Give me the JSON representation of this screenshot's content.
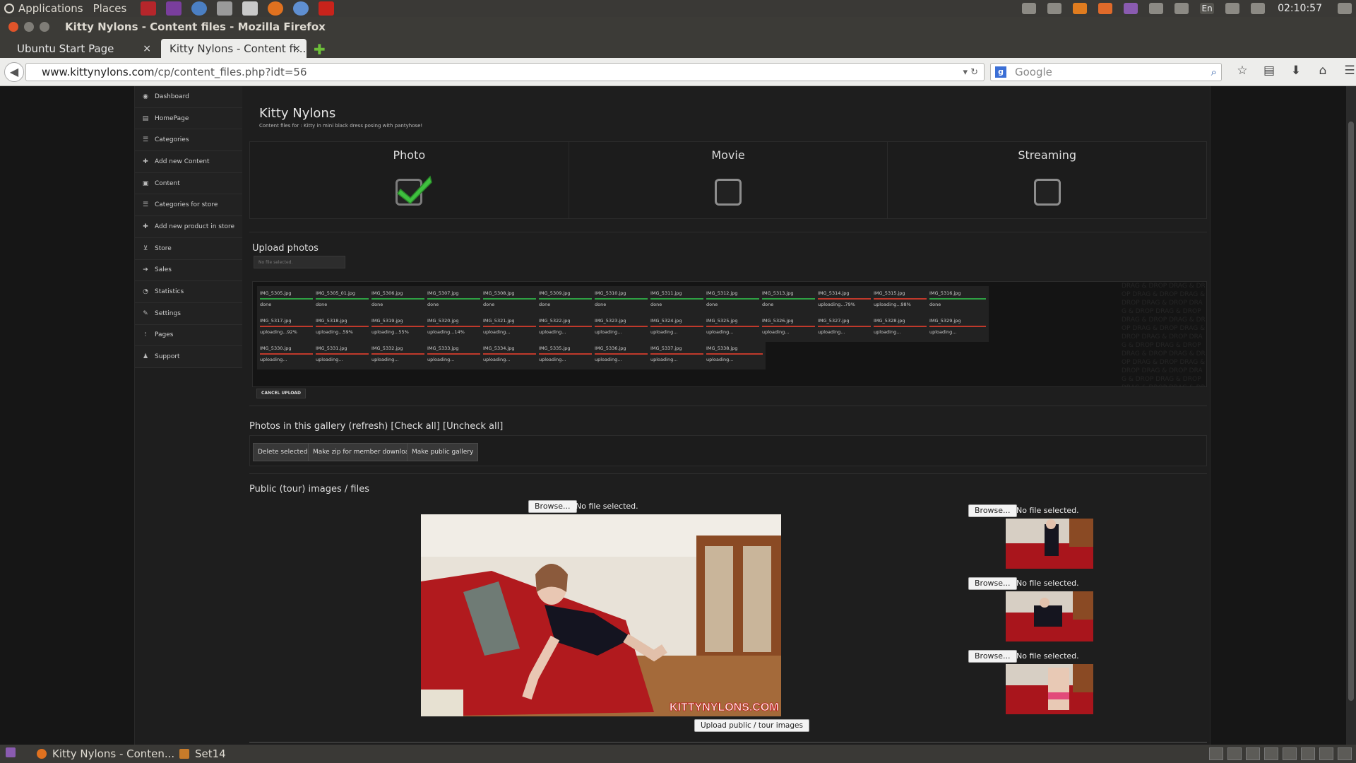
{
  "panel": {
    "menu_applications": "Applications",
    "menu_places": "Places",
    "clock": "02:10:57",
    "keyboard_layout": "En"
  },
  "window": {
    "title": "Kitty Nylons - Content files - Mozilla Firefox"
  },
  "tabs": [
    {
      "label": "Ubuntu Start Page",
      "close": "×"
    },
    {
      "label": "Kitty Nylons - Content fi...",
      "close": "×"
    }
  ],
  "nav": {
    "url_host": "www.kittynylons.com",
    "url_path": "/cp/content_files.php?idt=56",
    "search_placeholder": "Google"
  },
  "sidebar": {
    "items": [
      {
        "label": "Dashboard",
        "icon": "dashboard-icon",
        "glyph": "◉"
      },
      {
        "label": "HomePage",
        "icon": "homepage-icon",
        "glyph": "▤"
      },
      {
        "label": "Categories",
        "icon": "list-icon",
        "glyph": "☰"
      },
      {
        "label": "Add new Content",
        "icon": "plus-icon",
        "glyph": "✚"
      },
      {
        "label": "Content",
        "icon": "camera-icon",
        "glyph": "▣"
      },
      {
        "label": "Categories for store",
        "icon": "list-icon",
        "glyph": "☰"
      },
      {
        "label": "Add new product in store",
        "icon": "plus-icon",
        "glyph": "✚"
      },
      {
        "label": "Store",
        "icon": "cart-icon",
        "glyph": "⊻"
      },
      {
        "label": "Sales",
        "icon": "arrow-icon",
        "glyph": "➔"
      },
      {
        "label": "Statistics",
        "icon": "pie-chart-icon",
        "glyph": "◔"
      },
      {
        "label": "Settings",
        "icon": "edit-icon",
        "glyph": "✎"
      },
      {
        "label": "Pages",
        "icon": "pages-icon",
        "glyph": "⁝"
      },
      {
        "label": "Support",
        "icon": "user-icon",
        "glyph": "♟"
      }
    ]
  },
  "page": {
    "title": "Kitty Nylons",
    "subtitle": "Content files for : Kitty in mini black dress posing with pantyhose!"
  },
  "content_types": [
    {
      "label": "Photo",
      "checked": true
    },
    {
      "label": "Movie",
      "checked": false
    },
    {
      "label": "Streaming",
      "checked": false
    }
  ],
  "upload": {
    "title": "Upload photos",
    "input_placeholder": "No file selected.",
    "cancel_label": "CANCEL UPLOAD",
    "watermark": "DRAG & DROP",
    "files": [
      {
        "name": "IMG_5305.jpg",
        "status": "done"
      },
      {
        "name": "IMG_5305_01.jpg",
        "status": "done"
      },
      {
        "name": "IMG_5306.jpg",
        "status": "done"
      },
      {
        "name": "IMG_5307.jpg",
        "status": "done"
      },
      {
        "name": "IMG_5308.jpg",
        "status": "done"
      },
      {
        "name": "IMG_5309.jpg",
        "status": "done"
      },
      {
        "name": "IMG_5310.jpg",
        "status": "done"
      },
      {
        "name": "IMG_5311.jpg",
        "status": "done"
      },
      {
        "name": "IMG_5312.jpg",
        "status": "done"
      },
      {
        "name": "IMG_5313.jpg",
        "status": "done"
      },
      {
        "name": "IMG_5314.jpg",
        "status": "uploading...79%"
      },
      {
        "name": "IMG_5315.jpg",
        "status": "uploading...98%"
      },
      {
        "name": "IMG_5316.jpg",
        "status": "done"
      },
      {
        "name": "IMG_5317.jpg",
        "status": "uploading...92%"
      },
      {
        "name": "IMG_5318.jpg",
        "status": "uploading...59%"
      },
      {
        "name": "IMG_5319.jpg",
        "status": "uploading...55%"
      },
      {
        "name": "IMG_5320.jpg",
        "status": "uploading...14%"
      },
      {
        "name": "IMG_5321.jpg",
        "status": "uploading..."
      },
      {
        "name": "IMG_5322.jpg",
        "status": "uploading..."
      },
      {
        "name": "IMG_5323.jpg",
        "status": "uploading..."
      },
      {
        "name": "IMG_5324.jpg",
        "status": "uploading..."
      },
      {
        "name": "IMG_5325.jpg",
        "status": "uploading..."
      },
      {
        "name": "IMG_5326.jpg",
        "status": "uploading..."
      },
      {
        "name": "IMG_5327.jpg",
        "status": "uploading..."
      },
      {
        "name": "IMG_5328.jpg",
        "status": "uploading..."
      },
      {
        "name": "IMG_5329.jpg",
        "status": "uploading..."
      },
      {
        "name": "IMG_5330.jpg",
        "status": "uploading..."
      },
      {
        "name": "IMG_5331.jpg",
        "status": "uploading..."
      },
      {
        "name": "IMG_5332.jpg",
        "status": "uploading..."
      },
      {
        "name": "IMG_5333.jpg",
        "status": "uploading..."
      },
      {
        "name": "IMG_5334.jpg",
        "status": "uploading..."
      },
      {
        "name": "IMG_5335.jpg",
        "status": "uploading..."
      },
      {
        "name": "IMG_5336.jpg",
        "status": "uploading..."
      },
      {
        "name": "IMG_5337.jpg",
        "status": "uploading..."
      },
      {
        "name": "IMG_5338.jpg",
        "status": "uploading..."
      }
    ]
  },
  "gallery": {
    "title": "Photos in this gallery (refresh) [Check all] [Uncheck all]",
    "buttons": [
      "Delete selected",
      "Make zip for member download",
      "Make public gallery"
    ]
  },
  "public": {
    "title": "Public (tour) images / files",
    "browse_label": "Browse...",
    "no_file": "No file selected.",
    "watermark_text": "KITTYNYLONS.COM",
    "upload_label": "Upload public / tour images"
  },
  "taskbar": {
    "tasks": [
      "Kitty Nylons - Conten...",
      "Set14"
    ]
  },
  "colors": {
    "done_bar": "#2ea043",
    "uploading_bar": "#c0392b",
    "check_green": "#3fbf3f"
  }
}
